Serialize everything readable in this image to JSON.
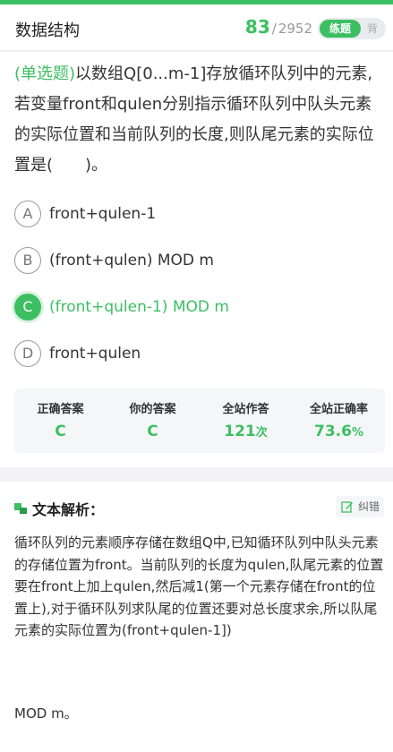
{
  "header": {
    "title": "数据结构",
    "current": "83",
    "separator": "/",
    "total": "2952",
    "mode_active": "练题",
    "mode_inactive": "背"
  },
  "question": {
    "type_label": "(单选题)",
    "text": "以数组Q[0...m-1]存放循环队列中的元素,若变量front和qulen分别指示循环队列中队头元素的实际位置和当前队列的长度,则队尾元素的实际位置是(　　)。"
  },
  "options": [
    {
      "letter": "A",
      "text": "front+qulen-1"
    },
    {
      "letter": "B",
      "text": "(front+qulen) MOD m"
    },
    {
      "letter": "C",
      "text": "(front+qulen-1) MOD m"
    },
    {
      "letter": "D",
      "text": "front+qulen"
    }
  ],
  "stats": {
    "correct_label": "正确答案",
    "correct_value": "C",
    "your_label": "你的答案",
    "your_value": "C",
    "attempts_label": "全站作答",
    "attempts_value": "121",
    "attempts_unit": "次",
    "rate_label": "全站正确率",
    "rate_value": "73.6",
    "rate_unit": "%"
  },
  "analysis": {
    "title": "文本解析：",
    "fix_label": "纠错",
    "body": "循环队列的元素顺序存储在数组Q中,已知循环队列中队头元素的存储位置为front。当前队列的长度为qulen,队尾元素的位置要在front上加上qulen,然后减1(第一个元素存储在front的位置上),对于循环队列求队尾的位置还要对总长度求余,所以队尾元素的实际位置为(front+qulen-1])",
    "body2": "MOD m。"
  },
  "colors": {
    "accent": "#3cbf62",
    "background": "#f3f3f5"
  }
}
